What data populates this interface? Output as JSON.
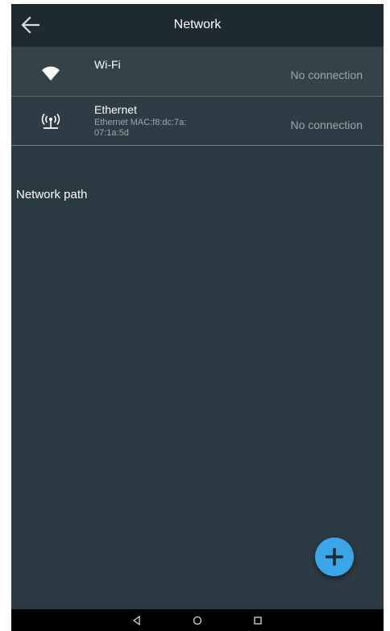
{
  "appbar": {
    "title": "Network",
    "back_icon": "arrow-back-icon"
  },
  "connections": [
    {
      "icon": "wifi-icon",
      "title": "Wi-Fi",
      "subtitle": "",
      "status": "No connection"
    },
    {
      "icon": "ethernet-antenna-icon",
      "title": "Ethernet",
      "subtitle": "Ethernet MAC:f8:dc:7a:\n07:1a:5d",
      "status": "No connection"
    }
  ],
  "section": {
    "title": "Network path"
  },
  "fab": {
    "icon": "plus-icon",
    "color": "#3aa6e8"
  },
  "navbar": {
    "back_icon": "nav-back-triangle-icon",
    "home_icon": "nav-home-circle-icon",
    "recents_icon": "nav-recents-square-icon"
  },
  "colors": {
    "background": "#2b3940",
    "appbar": "#1f2a30",
    "text_primary": "#ffffff",
    "text_secondary": "#9aa8ae"
  }
}
